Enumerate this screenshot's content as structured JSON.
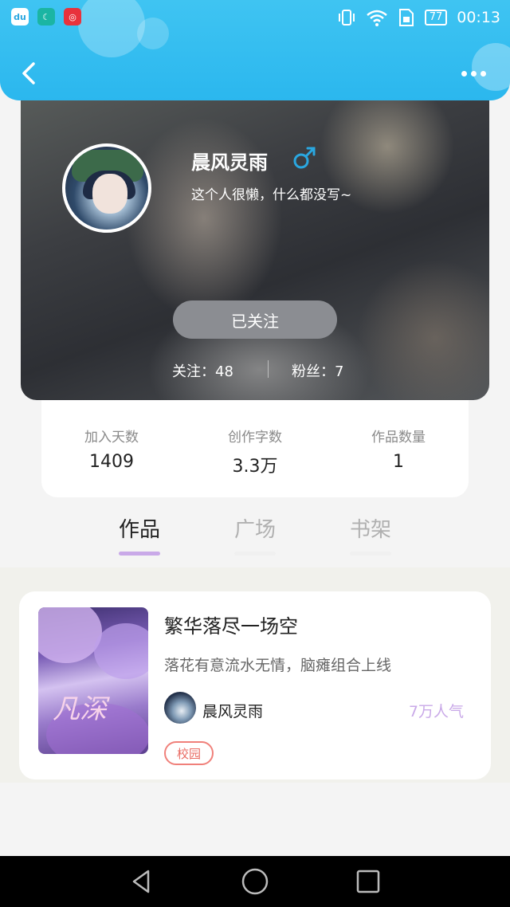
{
  "status_bar": {
    "time": "00:13",
    "battery": "77",
    "app_icons": [
      "du-icon",
      "moon-icon",
      "netease-music-icon"
    ],
    "app_icon_glyphs": [
      "du",
      "☾",
      "◎"
    ]
  },
  "header": {
    "back_icon": "chevron-left-icon",
    "more_icon": "more-dots-icon",
    "color": "#2bb7ee"
  },
  "profile": {
    "username": "晨风灵雨",
    "gender_icon": "male-icon",
    "gender_color": "#2aa7e0",
    "bio": "这个人很懒，什么都没写~",
    "follow_button": "已关注",
    "following": "关注：48",
    "fans": "粉丝：7"
  },
  "stats": [
    {
      "label": "加入天数",
      "value": "1409"
    },
    {
      "label": "创作字数",
      "value": "3.3万"
    },
    {
      "label": "作品数量",
      "value": "1"
    }
  ],
  "tabs": [
    {
      "label": "作品",
      "active": true
    },
    {
      "label": "广场",
      "active": false
    },
    {
      "label": "书架",
      "active": false
    }
  ],
  "work": {
    "title": "繁华落尽一场空",
    "description": "落花有意流水无情，脑瘫组合上线",
    "author": "晨风灵雨",
    "popularity": "7万人气",
    "tag": "校园",
    "cover_text": "凡深"
  },
  "nav_bar": {
    "icons": [
      "back-triangle-icon",
      "home-circle-icon",
      "recents-square-icon"
    ]
  }
}
